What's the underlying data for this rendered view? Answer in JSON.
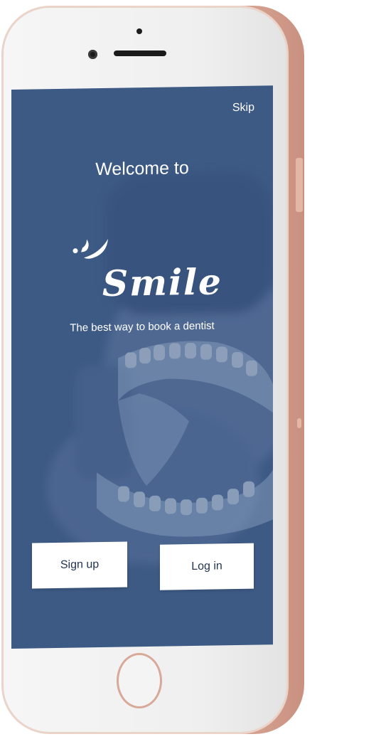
{
  "device": {
    "frame_color": "#e2b3a0",
    "home_button_icon": "home-button"
  },
  "welcome": {
    "heading": "Welcome to",
    "skip_label": "Skip",
    "logo_text": "Smile",
    "logo_icon": "smile-icon",
    "tagline": "The best way to book a dentist",
    "background_color": "#3d5a85",
    "signup_label": "Sign up",
    "login_label": "Log in"
  }
}
